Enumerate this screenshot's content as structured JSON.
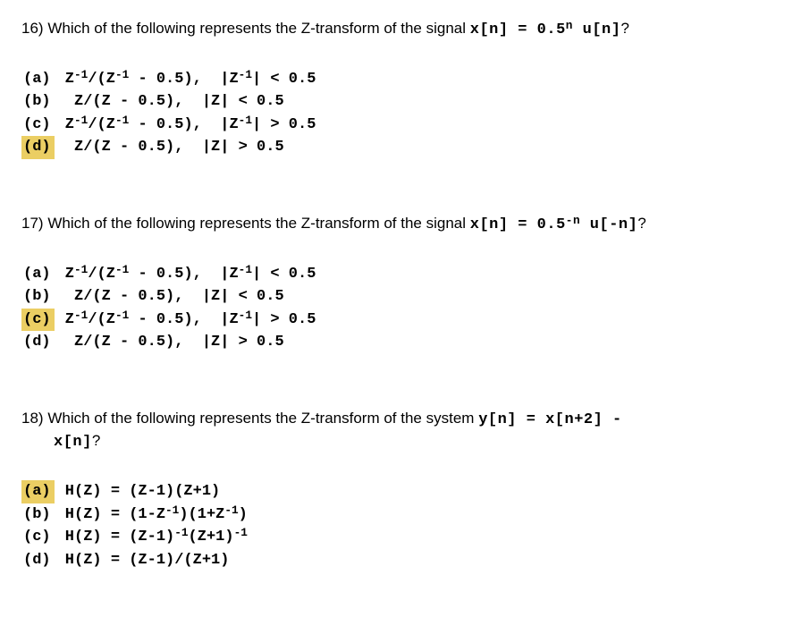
{
  "q16": {
    "number": "16)",
    "prompt_pre": "Which of the following represents the Z-transform of the signal ",
    "prompt_mono": "x[n] = 0.5",
    "prompt_sup": "n",
    "prompt_mono2": " u[n]",
    "prompt_post": "?",
    "opts": {
      "a": {
        "label": "(a)",
        "pre": " Z",
        "s1": "-1",
        "mid": "/(Z",
        "s2": "-1",
        "post": " - 0.5),  |Z",
        "s3": "-1",
        "tail": "| < 0.5",
        "hl": false
      },
      "b": {
        "label": "(b)",
        "text": "  Z/(Z - 0.5),  |Z| < 0.5",
        "hl": false
      },
      "c": {
        "label": "(c)",
        "pre": " Z",
        "s1": "-1",
        "mid": "/(Z",
        "s2": "-1",
        "post": " - 0.5),  |Z",
        "s3": "-1",
        "tail": "| > 0.5",
        "hl": false
      },
      "d": {
        "label": "(d)",
        "text": "  Z/(Z - 0.5),  |Z| > 0.5",
        "hl": true
      }
    }
  },
  "q17": {
    "number": "17)",
    "prompt_pre": "Which of the following represents the Z-transform of the signal ",
    "prompt_mono": "x[n] = 0.5",
    "prompt_sup": "-n",
    "prompt_mono2": " u[-n]",
    "prompt_post": "?",
    "opts": {
      "a": {
        "label": "(a)",
        "pre": " Z",
        "s1": "-1",
        "mid": "/(Z",
        "s2": "-1",
        "post": " - 0.5),  |Z",
        "s3": "-1",
        "tail": "| < 0.5",
        "hl": false
      },
      "b": {
        "label": "(b)",
        "text": "  Z/(Z - 0.5),  |Z| < 0.5",
        "hl": false
      },
      "c": {
        "label": "(c)",
        "pre": " Z",
        "s1": "-1",
        "mid": "/(Z",
        "s2": "-1",
        "post": " - 0.5),  |Z",
        "s3": "-1",
        "tail": "| > 0.5",
        "hl": true
      },
      "d": {
        "label": "(d)",
        "text": "  Z/(Z - 0.5),  |Z| > 0.5",
        "hl": false
      }
    }
  },
  "q18": {
    "number": "18)",
    "prompt_pre": "Which of the following represents the Z-transform of the system ",
    "prompt_mono": "y[n] = x[n+2] -",
    "prompt_mono_line2": "x[n]",
    "prompt_post": "?",
    "opts": {
      "a": {
        "label": "(a)",
        "text": " H(Z) = (Z-1)(Z+1)",
        "hl": true
      },
      "b": {
        "label": "(b)",
        "pre": " H(Z) = (1-Z",
        "s1": "-1",
        "mid": ")(1+Z",
        "s2": "-1",
        "post": ")",
        "hl": false
      },
      "c": {
        "label": "(c)",
        "pre": " H(Z) = (Z-1)",
        "s1": "-1",
        "mid": "(Z+1)",
        "s2": "-1",
        "post": "",
        "hl": false
      },
      "d": {
        "label": "(d)",
        "text": " H(Z) = (Z-1)/(Z+1)",
        "hl": false
      }
    }
  }
}
